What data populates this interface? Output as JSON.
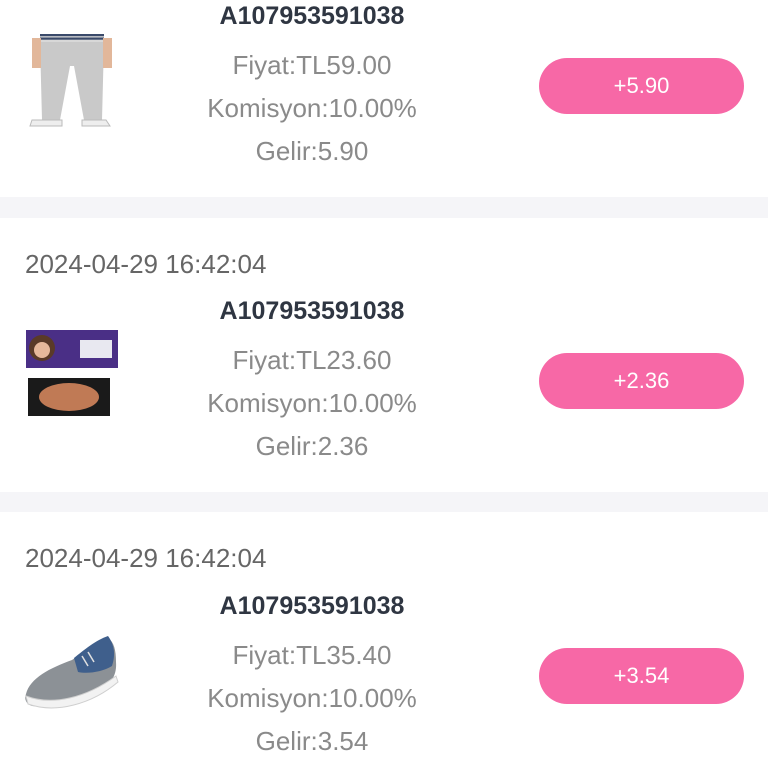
{
  "orders": [
    {
      "order_id": "A107953591038",
      "price": "Fiyat:TL59.00",
      "commission": "Komisyon:10.00%",
      "income": "Gelir:5.90",
      "amount": "+5.90",
      "product_icon": "trousers-icon"
    },
    {
      "date": "2024-04-29 16:42:04",
      "order_id": "A107953591038",
      "price": "Fiyat:TL23.60",
      "commission": "Komisyon:10.00%",
      "income": "Gelir:2.36",
      "amount": "+2.36",
      "product_icon": "makeup-palette-icon"
    },
    {
      "date": "2024-04-29 16:42:04",
      "order_id": "A107953591038",
      "price": "Fiyat:TL35.40",
      "commission": "Komisyon:10.00%",
      "income": "Gelir:3.54",
      "amount": "+3.54",
      "product_icon": "sneaker-icon"
    }
  ],
  "colors": {
    "accent": "#f768a6",
    "page_background": "#f5f5f8",
    "card_background": "#ffffff",
    "order_id_text": "#2f3642",
    "meta_text": "#8a8a8a"
  }
}
